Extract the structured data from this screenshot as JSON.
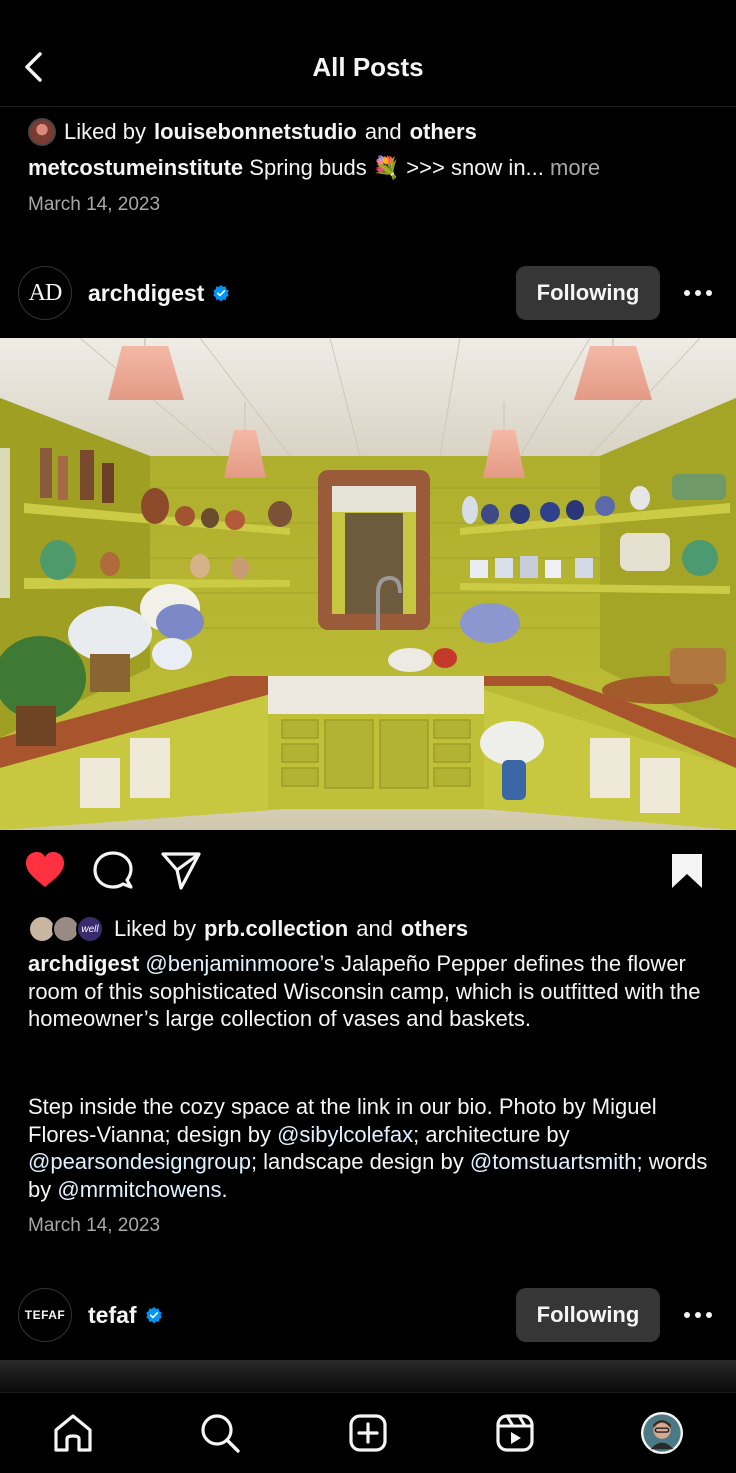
{
  "header": {
    "title": "All Posts"
  },
  "prev_post": {
    "liked_prefix": "Liked by",
    "liked_user": "louisebonnetstudio",
    "liked_mid": "and",
    "liked_others": "others",
    "author": "metcostumeinstitute",
    "caption": "Spring buds 💐 >>> snow in...",
    "more": "more",
    "date": "March 14, 2023"
  },
  "post": {
    "avatar_text": "AD",
    "username": "archdigest",
    "follow_label": "Following",
    "liked_prefix": "Liked by",
    "liked_user": "prb.collection",
    "liked_mid": "and",
    "liked_others": "others",
    "liker_badge": "well",
    "caption_author": "archdigest",
    "caption": {
      "m1": "@benjaminmoore",
      "t1": "’s Jalapeño Pepper defines the flower room of this sophisticated Wisconsin camp, which is outfitted with the homeowner’s large collection of vases and baskets.",
      "t2": "Step inside the cozy space at the link in our bio. Photo by Miguel Flores-Vianna; design by ",
      "m2": "@sibylcolefax",
      "t3": "; architecture by ",
      "m3": "@pearsondesigngroup",
      "t4": "; landscape design by ",
      "m4": "@tomstuartsmith",
      "t5": "; words by ",
      "m5": "@mrmitchowens",
      "t6": "."
    },
    "date": "March 14, 2023",
    "liked": true,
    "saved": true
  },
  "next_post": {
    "avatar_text": "TEFAF",
    "username": "tefaf",
    "follow_label": "Following"
  },
  "colors": {
    "like_red": "#ff3040",
    "verified_blue": "#0095f6",
    "wall": "#b7b82a"
  },
  "nav": [
    "home-icon",
    "search-icon",
    "create-icon",
    "reels-icon",
    "profile-avatar"
  ]
}
